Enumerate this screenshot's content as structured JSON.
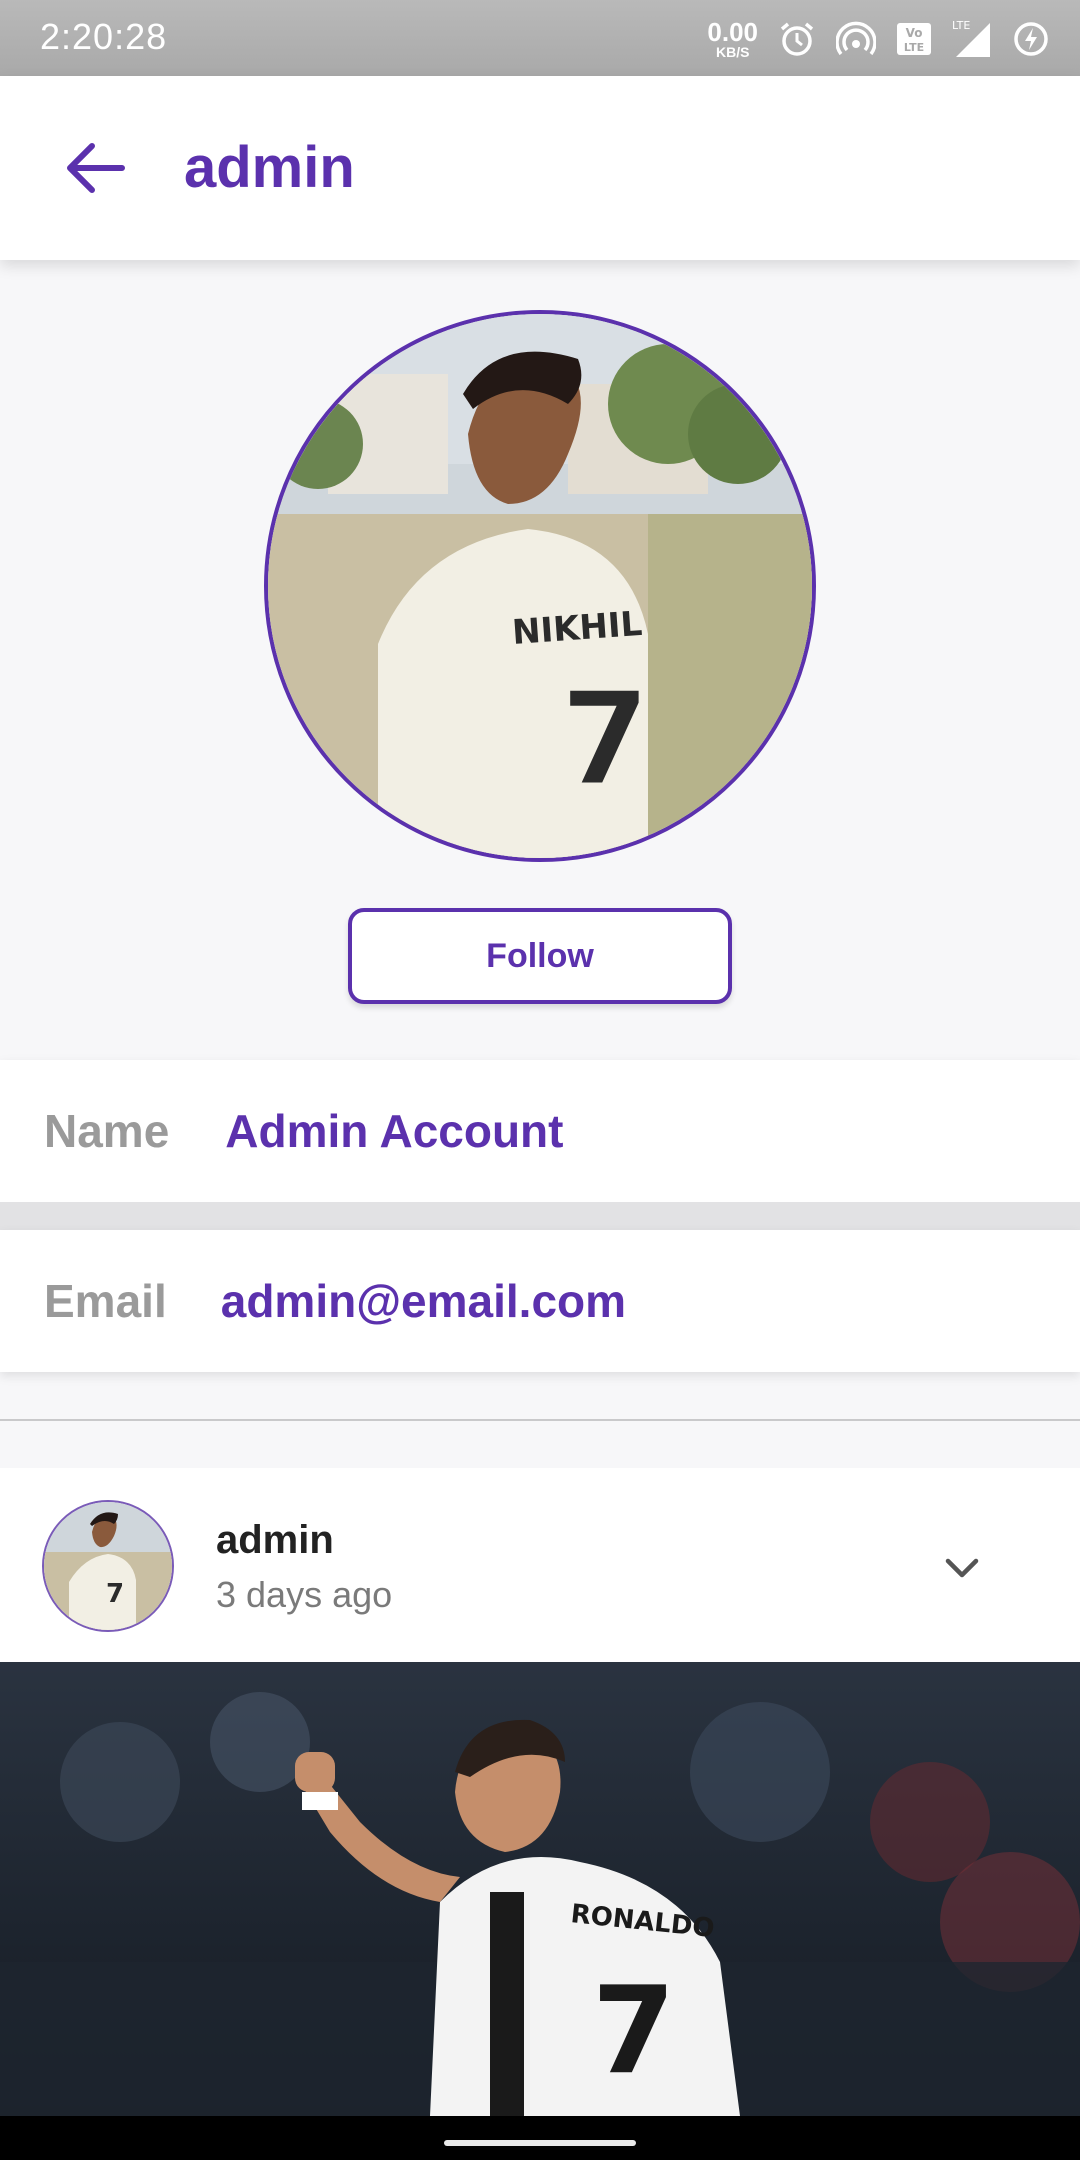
{
  "status_bar": {
    "time": "2:20:28",
    "net_speed_value": "0.00",
    "net_speed_unit": "KB/S",
    "icons": [
      "alarm-icon",
      "hotspot-icon",
      "volte-icon",
      "signal-icon",
      "battery-saver-icon"
    ]
  },
  "app_bar": {
    "title": "admin",
    "back_icon": "arrow-left-icon"
  },
  "profile": {
    "follow_label": "Follow",
    "name_label": "Name",
    "name_value": "Admin Account",
    "email_label": "Email",
    "email_value": "admin@email.com"
  },
  "post": {
    "author": "admin",
    "time": "3 days ago",
    "menu_icon": "chevron-down-icon"
  },
  "colors": {
    "accent": "#5b31ad",
    "label_gray": "#9a9a9a",
    "status_bar": "#b0b0b0"
  }
}
